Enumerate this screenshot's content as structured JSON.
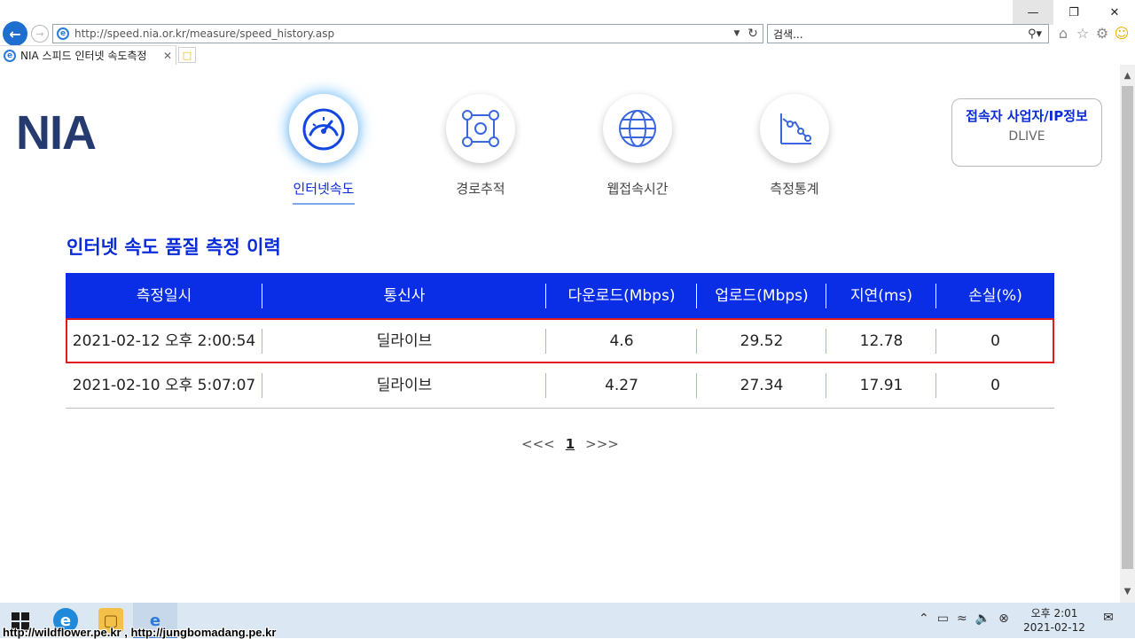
{
  "browser": {
    "address_url": "http://speed.nia.or.kr/measure/speed_history.asp",
    "search_placeholder": "검색...",
    "tab_title": "NIA 스피드 인터넷 속도측정"
  },
  "header": {
    "logo_text": "NIA",
    "menu": [
      {
        "label": "인터넷속도",
        "active": true
      },
      {
        "label": "경로추적",
        "active": false
      },
      {
        "label": "웹접속시간",
        "active": false
      },
      {
        "label": "측정통계",
        "active": false
      }
    ],
    "provider_box": {
      "title": "접속자 사업자/IP정보",
      "value": "DLIVE"
    }
  },
  "main": {
    "section_title": "인터넷 속도 품질 측정 이력",
    "table": {
      "columns": [
        "측정일시",
        "통신사",
        "다운로드(Mbps)",
        "업로드(Mbps)",
        "지연(ms)",
        "손실(%)"
      ],
      "rows": [
        {
          "datetime": "2021-02-12 오후 2:00:54",
          "carrier": "딜라이브",
          "download": "4.6",
          "upload": "29.52",
          "latency": "12.78",
          "loss": "0",
          "highlighted": true
        },
        {
          "datetime": "2021-02-10 오후 5:07:07",
          "carrier": "딜라이브",
          "download": "4.27",
          "upload": "27.34",
          "latency": "17.91",
          "loss": "0",
          "highlighted": false
        }
      ]
    },
    "pagination": {
      "prev": "<<<",
      "current": "1",
      "next": ">>>"
    }
  },
  "taskbar": {
    "clock_time": "오후 2:01",
    "clock_date": "2021-02-12"
  },
  "watermark": "http://wildflower.pe.kr , http://jungbomadang.pe.kr",
  "colors": {
    "accent": "#0a2ee6",
    "title": "#0a2bd8",
    "logo": "#253a6e",
    "highlight_border": "#e01b1b"
  }
}
